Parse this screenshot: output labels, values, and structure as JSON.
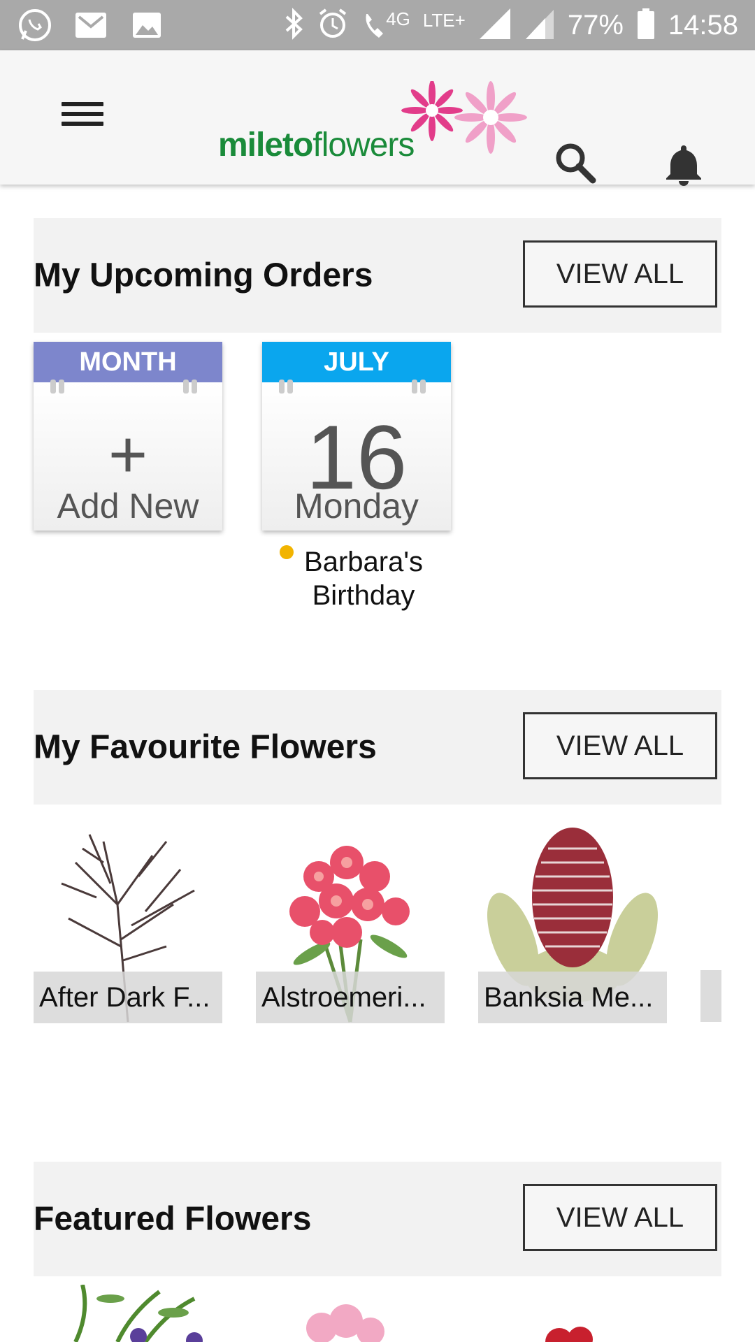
{
  "status_bar": {
    "network_small": "4G",
    "network": "LTE+",
    "battery": "77%",
    "time": "14:58"
  },
  "header": {
    "logo_bold": "mileto",
    "logo_light": "flowers"
  },
  "upcoming": {
    "title": "My Upcoming Orders",
    "view_all": "VIEW ALL",
    "add_card": {
      "month": "MONTH",
      "symbol": "+",
      "label": "Add New",
      "color": "#7d86cc"
    },
    "order_card": {
      "month": "JULY",
      "day": "16",
      "weekday": "Monday",
      "color": "#0aa6ee"
    },
    "event": "Barbara's Birthday",
    "event_dot_color": "#f2b400"
  },
  "favourites": {
    "title": "My Favourite Flowers",
    "view_all": "VIEW ALL",
    "items": [
      {
        "label": "After Dark F..."
      },
      {
        "label": "Alstroemeri..."
      },
      {
        "label": "Banksia Me..."
      }
    ]
  },
  "featured": {
    "title": "Featured Flowers",
    "view_all": "VIEW ALL"
  }
}
